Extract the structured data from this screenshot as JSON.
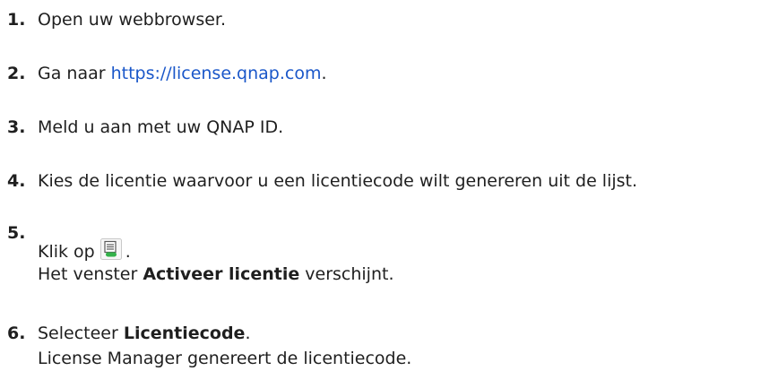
{
  "steps": [
    {
      "num": "1.",
      "text": "Open uw webbrowser."
    },
    {
      "num": "2.",
      "pre": "Ga naar ",
      "link": "https://license.qnap.com",
      "post": "."
    },
    {
      "num": "3.",
      "text": "Meld u aan met uw QNAP ID."
    },
    {
      "num": "4.",
      "text": "Kies de licentie waarvoor u een licentiecode wilt genereren uit de lijst."
    },
    {
      "num": "5.",
      "pre": "Klik op",
      "post": ".",
      "line2_pre": "Het venster ",
      "line2_bold": "Activeer licentie",
      "line2_post": " verschijnt."
    },
    {
      "num": "6.",
      "pre": "Selecteer ",
      "bold": "Licentiecode",
      "post": ".",
      "line2": "License Manager genereert de licentiecode."
    }
  ],
  "icons": {
    "step5": "license-action-icon"
  }
}
